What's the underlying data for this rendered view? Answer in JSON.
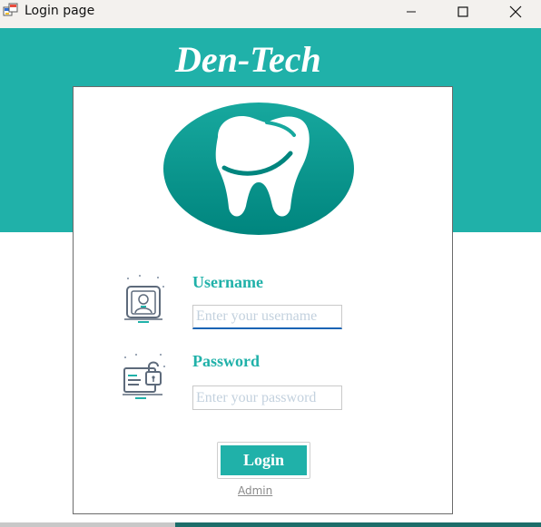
{
  "window": {
    "title": "Login page",
    "controls": {
      "minimize": "minimize",
      "maximize": "maximize",
      "close": "close"
    }
  },
  "brand": "Den-Tech",
  "logo": {
    "icon": "tooth-icon",
    "colors": {
      "dark": "#00857e",
      "light": "#11a59b"
    }
  },
  "form": {
    "username_label": "Username",
    "username_placeholder": "Enter your username",
    "username_value": "",
    "password_label": "Password",
    "password_placeholder": "Enter your password",
    "password_value": "",
    "login_label": "Login",
    "admin_link": "Admin"
  },
  "colors": {
    "accent": "#20b1a9",
    "focus_underline": "#1a64b5",
    "link": "#8a8a8a"
  }
}
